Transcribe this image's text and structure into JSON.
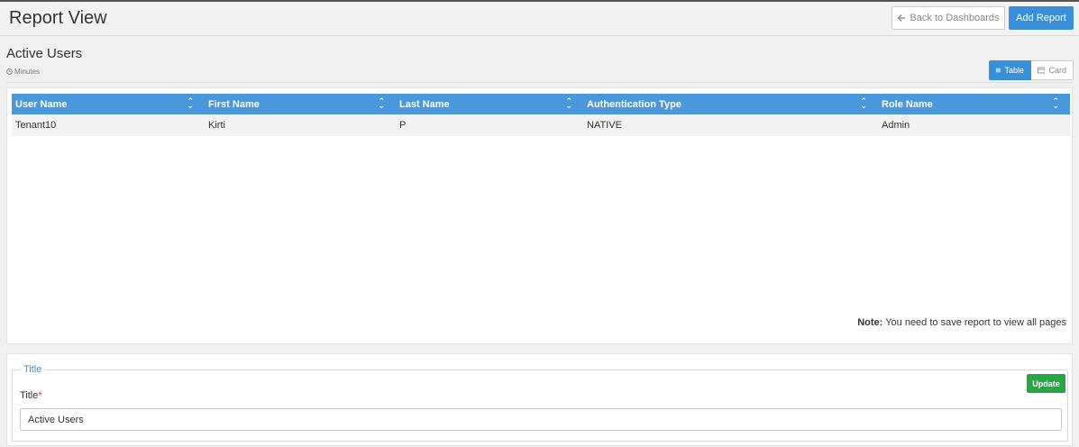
{
  "header": {
    "title": "Report View",
    "back_label": "Back to Dashboards",
    "add_label": "Add Report"
  },
  "report": {
    "name": "Active Users",
    "refresh": "Minutes"
  },
  "view_toggle": {
    "table_label": "Table",
    "card_label": "Card",
    "active": "Table"
  },
  "table": {
    "columns": [
      "User Name",
      "First Name",
      "Last Name",
      "Authentication Type",
      "Role Name"
    ],
    "rows": [
      [
        "Tenant10",
        "Kirti",
        "P",
        "NATIVE",
        "Admin"
      ]
    ]
  },
  "note": {
    "label": "Note:",
    "text": "You need to save report to view all pages"
  },
  "form": {
    "legend": "Title",
    "field_label": "Title",
    "required_mark": "*",
    "update_label": "Update",
    "title_value": "Active Users"
  },
  "colors": {
    "primary": "#3a8fd9",
    "table_header": "#4a97dc",
    "success": "#27a744"
  }
}
